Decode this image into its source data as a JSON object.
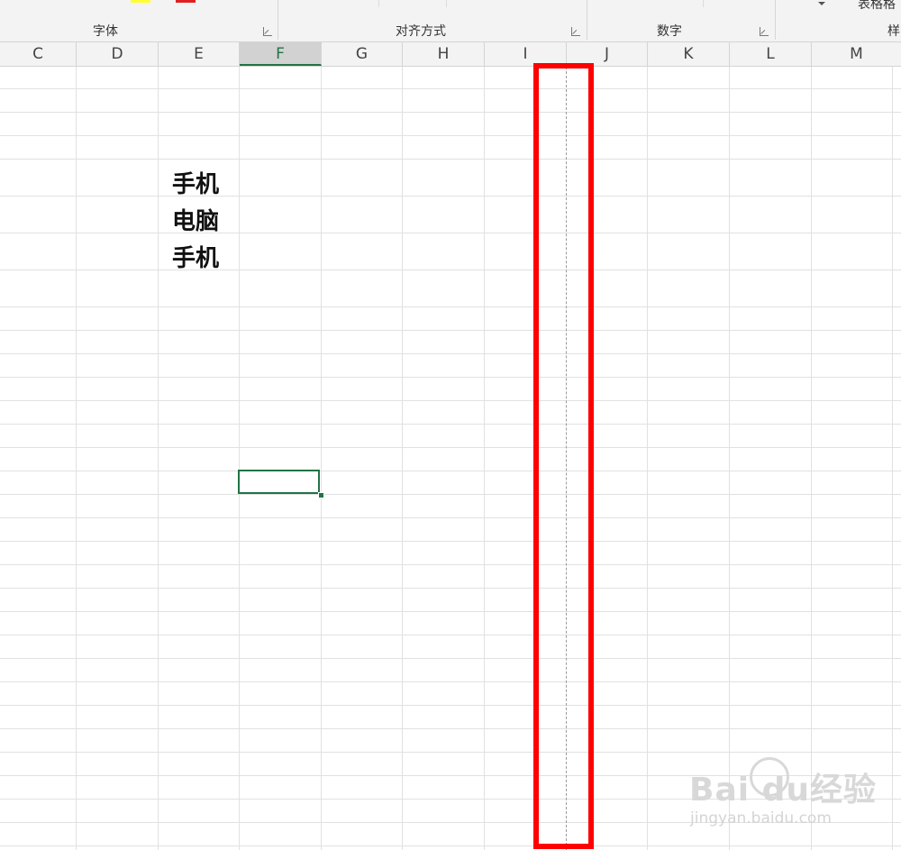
{
  "ribbon": {
    "groups": [
      "字体",
      "对齐方式",
      "数字",
      "样"
    ],
    "format_label": "表格格",
    "font_color_swatch": "#ffff00",
    "fill_color_swatch": "#ff0000"
  },
  "columns": [
    "C",
    "D",
    "E",
    "F",
    "G",
    "H",
    "I",
    "J",
    "K",
    "L",
    "M"
  ],
  "selected_column": "F",
  "cells": {
    "e_row5": "手机",
    "e_row6": "电脑",
    "e_row7": "手机"
  },
  "colors": {
    "accent": "#217346",
    "highlight": "#ff0000",
    "gridline": "#e1e1e1"
  },
  "watermark": {
    "logo": "Bai du经验",
    "url": "jingyan.baidu.com"
  }
}
